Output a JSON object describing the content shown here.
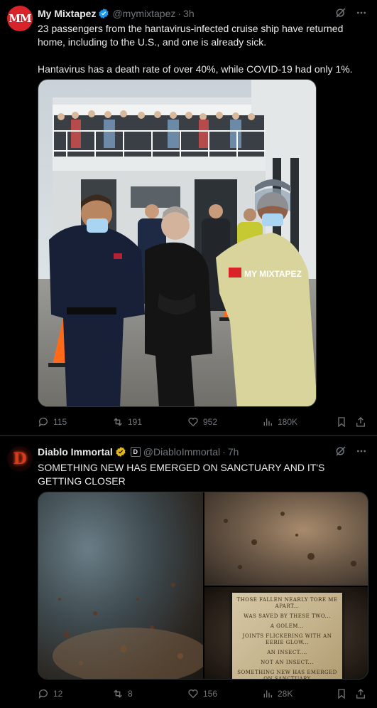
{
  "tweet1": {
    "avatar_text": "MM",
    "name": "My Mixtapez",
    "handle": "@mymixtapez",
    "separator": "·",
    "time": "3h",
    "text_line1": "23 passengers from the hantavirus-infected cruise ship have returned home, including to the U.S., and one is already sick.",
    "text_line2": "Hantavirus has a death rate of over 40%, while COVID-19 had only 1%.",
    "watermark": "MY MIXTAPEZ",
    "actions": {
      "replies": "115",
      "reposts": "191",
      "likes": "952",
      "views": "180K"
    }
  },
  "tweet2": {
    "avatar_text": "D",
    "name": "Diablo Immortal",
    "affiliate_badge": "D",
    "handle": "@DiabloImmortal",
    "separator": "·",
    "time": "7h",
    "text": "SOMETHING NEW HAS EMERGED ON SANCTUARY AND IT'S GETTING CLOSER",
    "poem_lines": [
      "THOSE FALLEN NEARLY TORE ME APART...",
      "WAS SAVED BY THESE TWO...",
      "A GOLEM...",
      "JOINTS FLICKERING WITH AN EERIE GLOW...",
      "AN INSECT....",
      "NOT AN INSECT...",
      "SOMETHING NEW HAS EMERGED ON SANCTUARY"
    ],
    "actions": {
      "replies": "12",
      "reposts": "8",
      "likes": "156",
      "views": "28K"
    }
  },
  "icons": [
    "verified-icon",
    "grok-icon",
    "more-icon",
    "reply-icon",
    "repost-icon",
    "like-icon",
    "views-icon",
    "bookmark-icon",
    "share-icon"
  ],
  "colors": {
    "background": "#000000",
    "text": "#e7e9ea",
    "secondary": "#71767b",
    "border": "#2f3336",
    "verified_blue": "#1d9bf0",
    "gold_badge": "#e2b719"
  }
}
